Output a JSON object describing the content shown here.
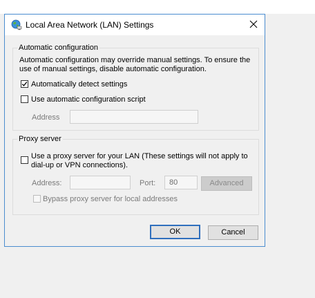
{
  "dialog": {
    "title": "Local Area Network (LAN) Settings",
    "icon": "network-globe-icon",
    "close_icon": "close-icon"
  },
  "auto_config": {
    "legend": "Automatic configuration",
    "description": "Automatic configuration may override manual settings.  To ensure the use of manual settings, disable automatic configuration.",
    "detect_label": "Automatically detect settings",
    "detect_checked": true,
    "script_label": "Use automatic configuration script",
    "script_checked": false,
    "address_label": "Address",
    "address_value": ""
  },
  "proxy": {
    "legend": "Proxy server",
    "use_proxy_label_line1": "Use a proxy server for your LAN (These settings will not apply to",
    "use_proxy_label_line2": "dial-up or VPN connections).",
    "use_proxy_checked": false,
    "address_label": "Address:",
    "address_value": "",
    "port_label": "Port:",
    "port_value": "80",
    "advanced_label": "Advanced",
    "bypass_label": "Bypass proxy server for local addresses",
    "bypass_checked": false
  },
  "buttons": {
    "ok_label": "OK",
    "cancel_label": "Cancel"
  },
  "colors": {
    "dialog_border": "#4a8ccf",
    "default_button_border": "#2f6fbd",
    "background": "#f0f0f0"
  }
}
